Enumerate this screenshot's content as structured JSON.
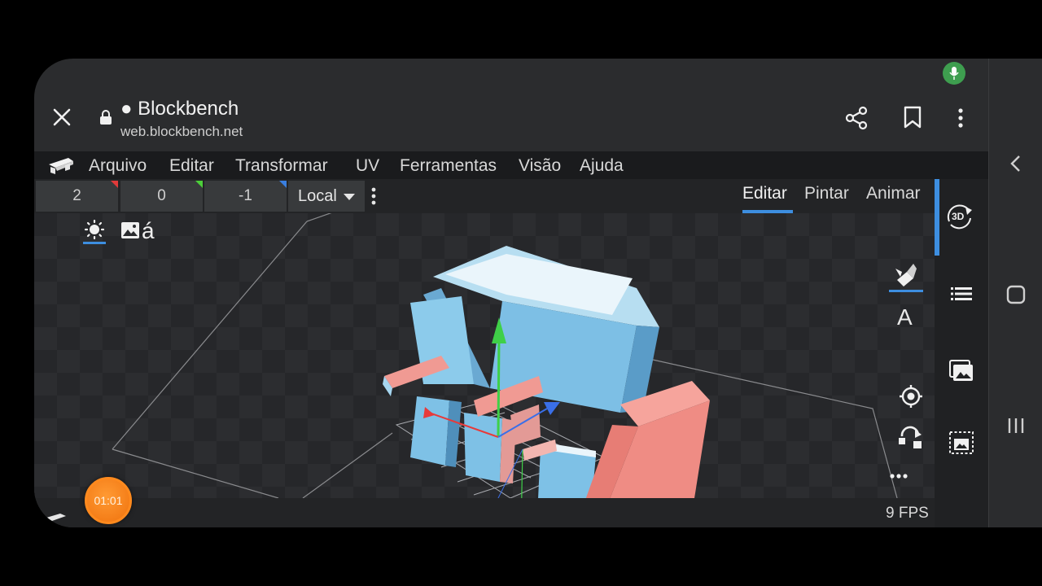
{
  "browser": {
    "title": "● Blockbench",
    "url": "web.blockbench.net",
    "icons": [
      "close-icon",
      "lock-icon",
      "share-icon",
      "bookmark-icon",
      "more-vert-icon",
      "mic-icon"
    ]
  },
  "menubar": {
    "items": [
      "Arquivo",
      "Editar",
      "Transformar",
      "UV",
      "Ferramentas",
      "Visão",
      "Ajuda"
    ]
  },
  "toolbar": {
    "fields": [
      {
        "value": "2",
        "axis_color": "#e03a3a"
      },
      {
        "value": "0",
        "axis_color": "#4ccf3a"
      },
      {
        "value": "-1",
        "axis_color": "#3a7fe0"
      }
    ],
    "space_select": "Local",
    "modes": [
      "Editar",
      "Pintar",
      "Animar"
    ],
    "active_mode": "Editar"
  },
  "viewport": {
    "fps": "9 FPS",
    "timer": "01:01",
    "view_icon_text": "á",
    "colors": {
      "model_blue": "#6fb3dd",
      "model_pink": "#f08a84",
      "accent": "#3d8ee0"
    }
  },
  "right_panel": {
    "badge_3d": "3D",
    "text_tool": "A"
  }
}
